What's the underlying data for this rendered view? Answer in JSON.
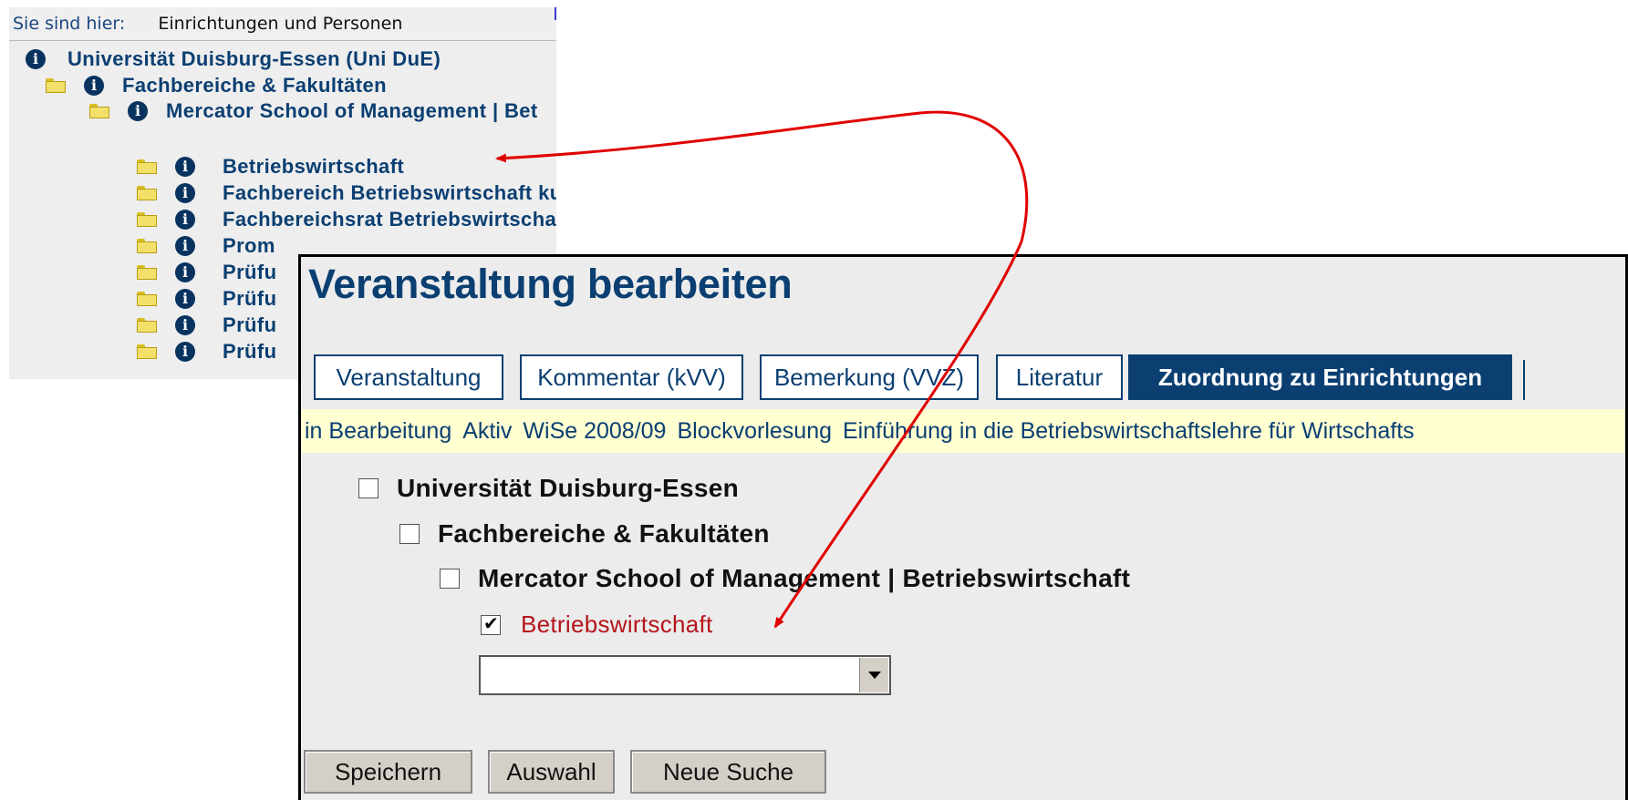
{
  "tree": {
    "breadcrumb_label": "Sie sind hier:",
    "breadcrumb_value": "Einrichtungen und Personen",
    "items": [
      {
        "label": "Universität Duisburg-Essen   (Uni DuE)"
      },
      {
        "label": "Fachbereiche & Fakultäten"
      },
      {
        "label": "Mercator School of Management | Bet"
      },
      {
        "label": "Betriebswirtschaft"
      },
      {
        "label": "Fachbereich Betriebswirtschaft ku"
      },
      {
        "label": "Fachbereichsrat Betriebswirtscha"
      },
      {
        "label": "Prom"
      },
      {
        "label": "Prüfu"
      },
      {
        "label": "Prüfu"
      },
      {
        "label": "Prüfu"
      },
      {
        "label": "Prüfu"
      }
    ]
  },
  "editor": {
    "title": "Veranstaltung bearbeiten",
    "tabs": [
      {
        "label": "Veranstaltung"
      },
      {
        "label": "Kommentar (kVV)"
      },
      {
        "label": "Bemerkung (VVZ)"
      },
      {
        "label": "Literatur"
      },
      {
        "label": "Zuordnung zu Einrichtungen",
        "active": true
      }
    ],
    "status": {
      "state": "in Bearbeitung",
      "activity": "Aktiv",
      "term": "WiSe 2008/09",
      "format": "Blockvorlesung",
      "course": "Einführung in die Betriebswirtschaftslehre für Wirtschafts"
    },
    "checkboxes": [
      {
        "label": "Universität Duisburg-Essen",
        "checked": false
      },
      {
        "label": "Fachbereiche & Fakultäten",
        "checked": false
      },
      {
        "label": "Mercator School of Management | Betriebswirtschaft",
        "checked": false
      },
      {
        "label": "Betriebswirtschaft",
        "checked": true
      }
    ],
    "select": {
      "value": ""
    },
    "buttons": {
      "save": "Speichern",
      "selection": "Auswahl",
      "new_search": "Neue Suche"
    }
  },
  "colors": {
    "accent": "#0b3f72",
    "arrow": "#e00000",
    "status_bg": "#ffffd2",
    "checked_label": "#b4151b"
  }
}
